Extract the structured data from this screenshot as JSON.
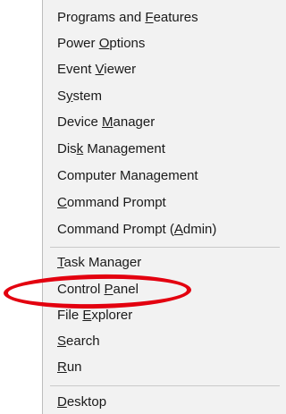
{
  "menu": {
    "items": [
      {
        "pre": "Programs and ",
        "key": "F",
        "post": "eatures"
      },
      {
        "pre": "Power ",
        "key": "O",
        "post": "ptions"
      },
      {
        "pre": "Event ",
        "key": "V",
        "post": "iewer"
      },
      {
        "pre": "S",
        "key": "y",
        "post": "stem"
      },
      {
        "pre": "Device ",
        "key": "M",
        "post": "anager"
      },
      {
        "pre": "Dis",
        "key": "k",
        "post": " Management"
      },
      {
        "pre": "Computer Mana",
        "key": "g",
        "post": "ement"
      },
      {
        "pre": "",
        "key": "C",
        "post": "ommand Prompt"
      },
      {
        "pre": "Command Prompt (",
        "key": "A",
        "post": "dmin)"
      },
      {
        "pre": "",
        "key": "T",
        "post": "ask Manager"
      },
      {
        "pre": "Control ",
        "key": "P",
        "post": "anel"
      },
      {
        "pre": "File ",
        "key": "E",
        "post": "xplorer"
      },
      {
        "pre": "",
        "key": "S",
        "post": "earch"
      },
      {
        "pre": "",
        "key": "R",
        "post": "un"
      },
      {
        "pre": "",
        "key": "D",
        "post": "esktop"
      }
    ]
  },
  "annotation": {
    "color": "#e3000f"
  }
}
